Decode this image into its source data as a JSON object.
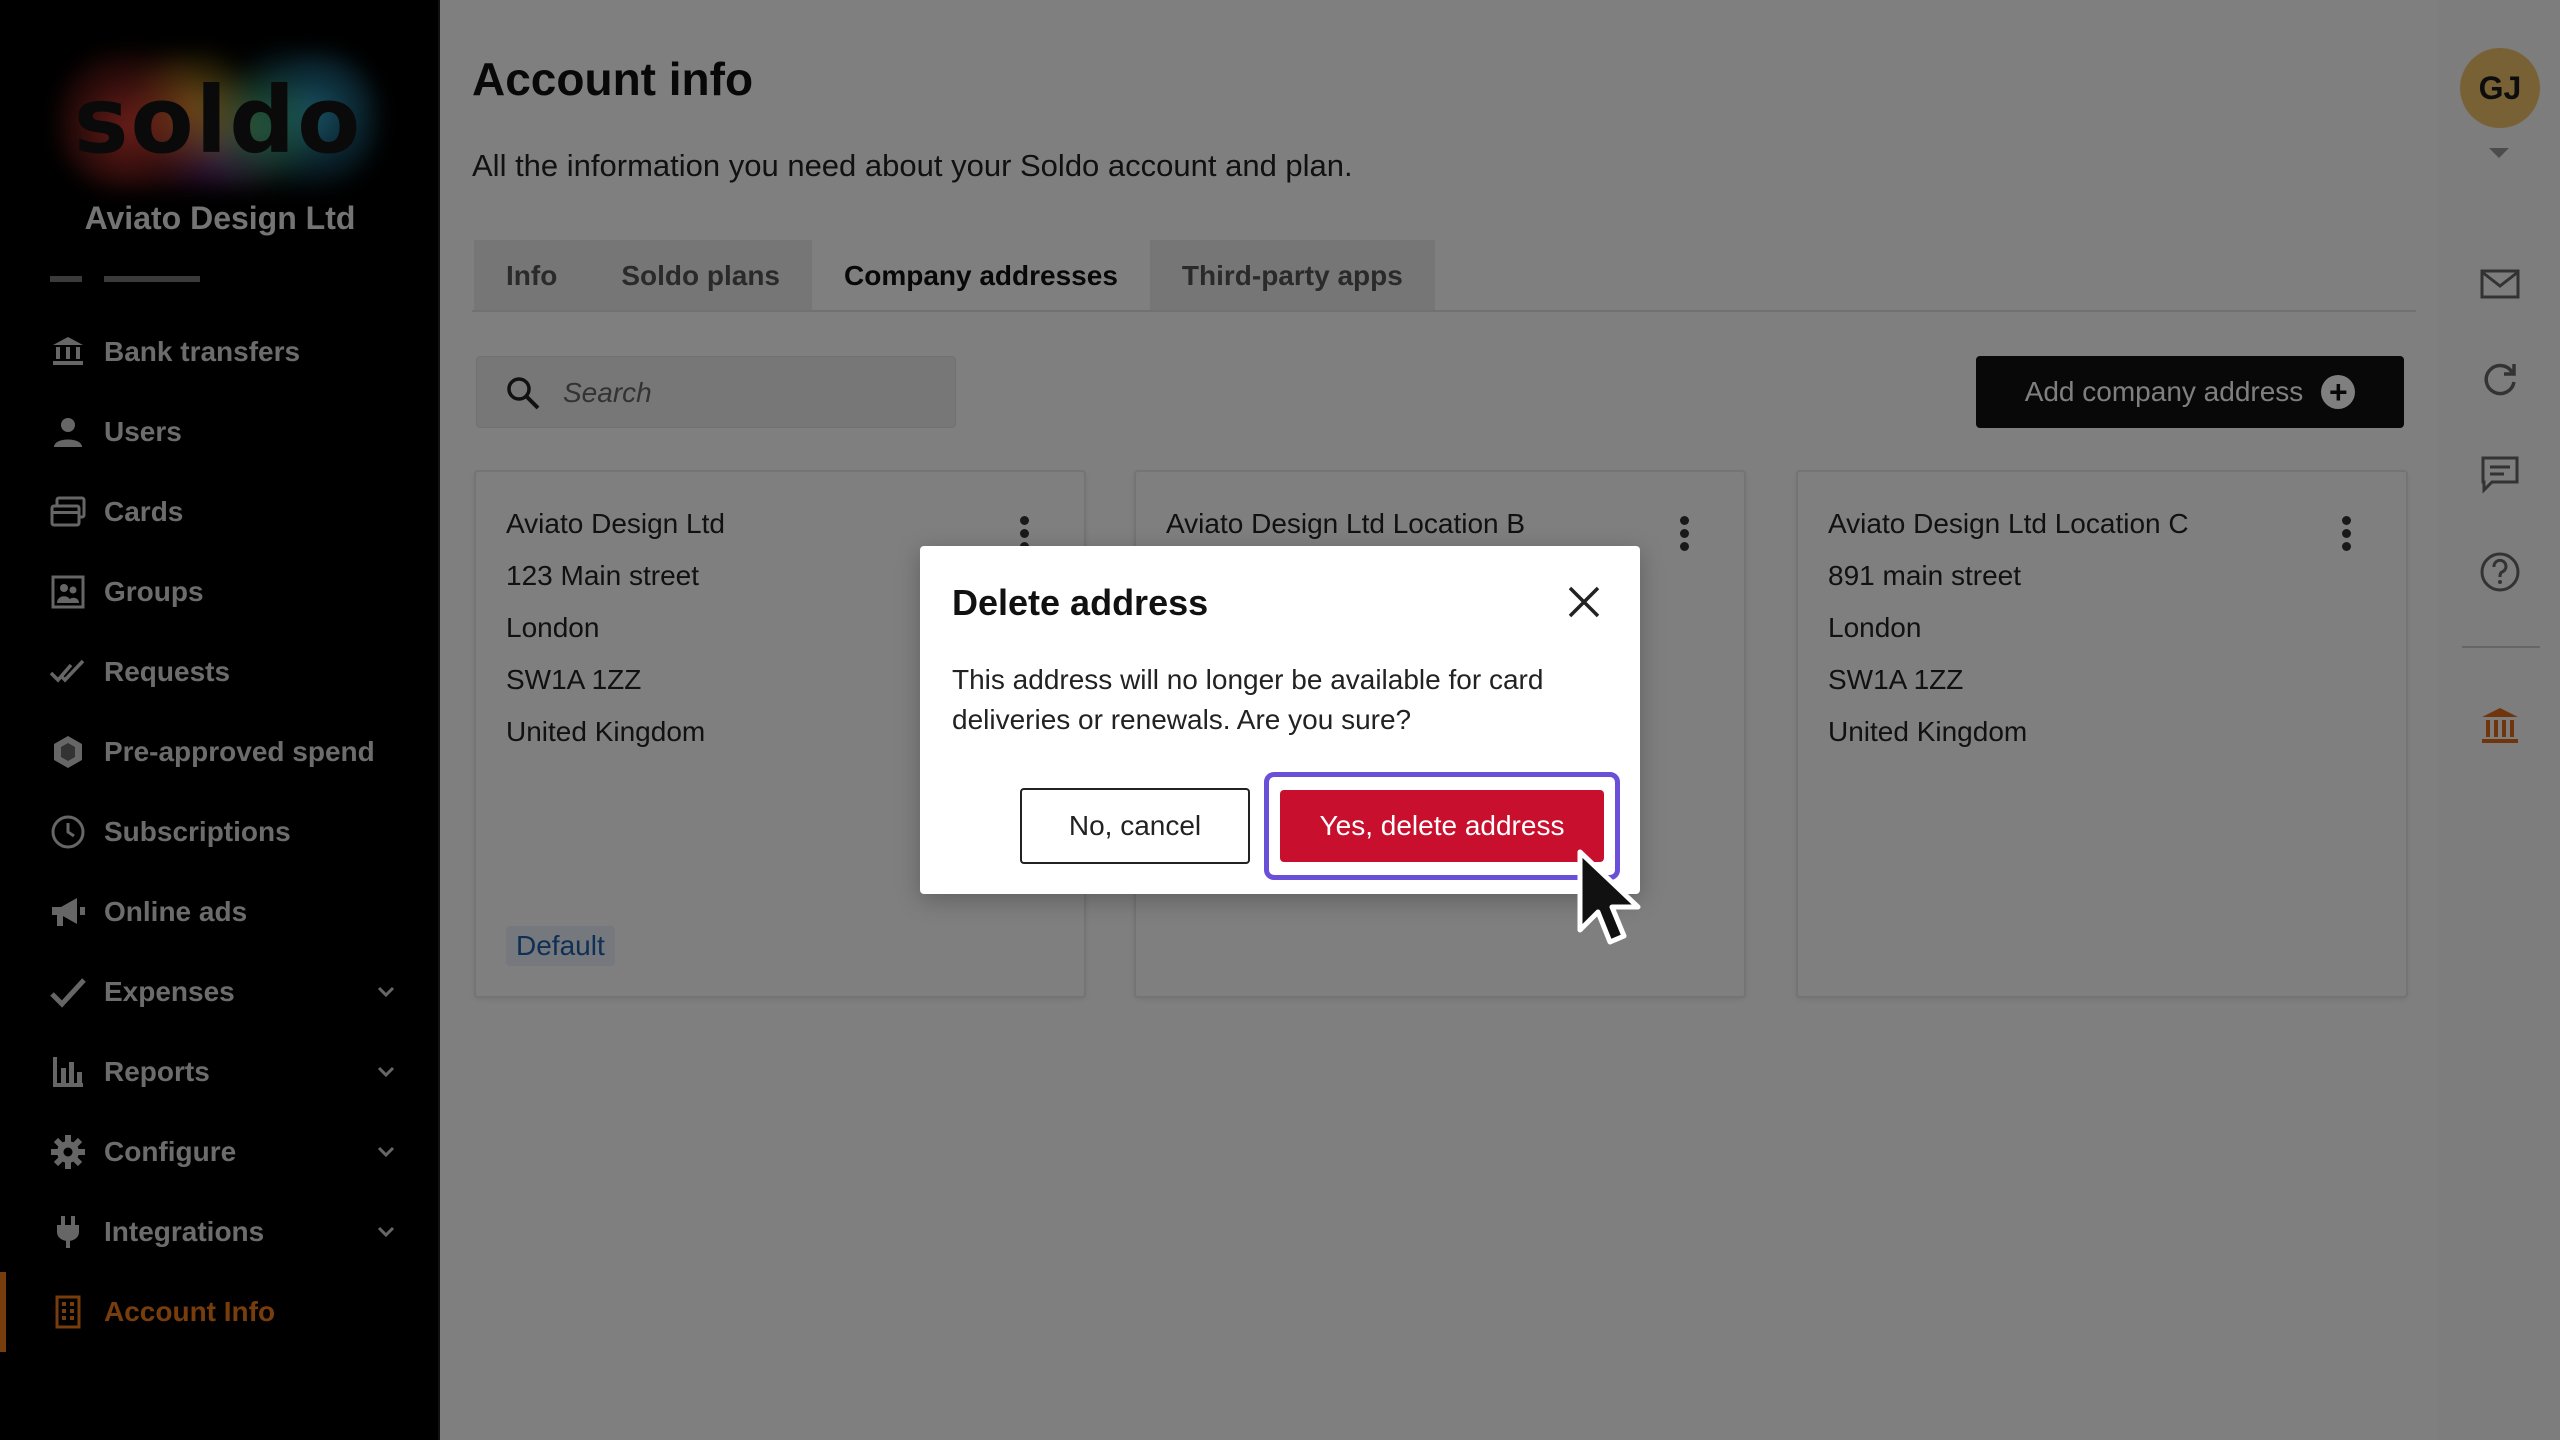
{
  "sidebar": {
    "logo_text": "soldo",
    "company_name": "Aviato Design Ltd",
    "items": [
      {
        "label": "Bank transfers",
        "icon": "bank-transfer-icon"
      },
      {
        "label": "Users",
        "icon": "user-icon"
      },
      {
        "label": "Cards",
        "icon": "cards-icon"
      },
      {
        "label": "Groups",
        "icon": "groups-icon"
      },
      {
        "label": "Requests",
        "icon": "requests-icon"
      },
      {
        "label": "Pre-approved spend",
        "icon": "pre-approved-icon"
      },
      {
        "label": "Subscriptions",
        "icon": "clock-icon"
      },
      {
        "label": "Online ads",
        "icon": "megaphone-icon"
      },
      {
        "label": "Expenses",
        "icon": "checkmark-icon",
        "expandable": true
      },
      {
        "label": "Reports",
        "icon": "bar-chart-icon",
        "expandable": true
      },
      {
        "label": "Configure",
        "icon": "gear-icon",
        "expandable": true
      },
      {
        "label": "Integrations",
        "icon": "plug-icon",
        "expandable": true
      },
      {
        "label": "Account Info",
        "icon": "building-icon",
        "active": true
      }
    ],
    "active_color": "#f07a1a"
  },
  "header": {
    "title": "Account info",
    "subtitle": "All the information you need about your Soldo account and plan."
  },
  "tabs": [
    {
      "label": "Info"
    },
    {
      "label": "Soldo plans"
    },
    {
      "label": "Company addresses",
      "active": true
    },
    {
      "label": "Third-party apps"
    }
  ],
  "search": {
    "placeholder": "Search",
    "value": ""
  },
  "add_button": {
    "label": "Add company address"
  },
  "addresses": [
    {
      "lines": [
        "Aviato Design Ltd",
        "123 Main street",
        "London",
        "SW1A 1ZZ",
        "United Kingdom"
      ],
      "badge": "Default"
    },
    {
      "lines": [
        "Aviato Design Ltd Location B"
      ]
    },
    {
      "lines": [
        "Aviato Design Ltd Location C",
        "891 main street",
        "London",
        "SW1A 1ZZ",
        "United Kingdom"
      ]
    }
  ],
  "user": {
    "initials": "GJ",
    "avatar_color": "#f0c36b"
  },
  "rail_icons": [
    "mail-icon",
    "refresh-icon",
    "chat-icon",
    "help-icon",
    "bank-icon"
  ],
  "modal": {
    "title": "Delete address",
    "body": "This address will no longer be available for card deliveries or renewals. Are you sure?",
    "cancel_label": "No, cancel",
    "confirm_label": "Yes, delete address",
    "confirm_color": "#c8102e",
    "focus_color": "#6a4fd8"
  }
}
